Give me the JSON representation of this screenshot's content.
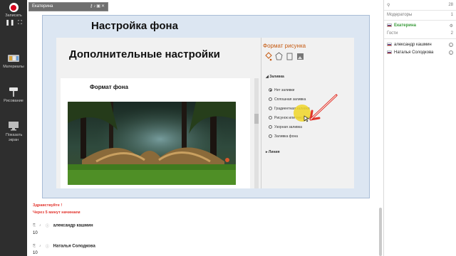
{
  "leftbar": {
    "record_label": "Записать",
    "materials_label": "Материалы",
    "drawing_label": "Рисование",
    "share_label": "Показать экран"
  },
  "video": {
    "title": "Екатерина"
  },
  "slide": {
    "title": "Настройка фона",
    "inner_title": "Дополнительные настройки",
    "format_label": "Формат фона",
    "pane_title": "Формат рисунка",
    "pane_section": "Заливка",
    "options": [
      "Нет заливки",
      "Сплошная заливка",
      "Градиентная заливка",
      "Рисунок или текстура",
      "Узорная заливка",
      "Заливка фона"
    ],
    "pane_line": "Линия"
  },
  "chat": {
    "greeting": "Здравствуйте !",
    "start_note": "Через 5 минут начинаем",
    "messages": [
      {
        "author": "александр кашмин",
        "text": "10"
      },
      {
        "author": "Наталья Солодкова",
        "text": "10"
      }
    ]
  },
  "right": {
    "top_count": "28",
    "moderators_label": "Модераторы",
    "moderators_count": "1",
    "moderator_name": "Екатерина",
    "guests_label": "Гости",
    "guests_count": "2",
    "guests": [
      "александр кашмин",
      "Наталья Солодкова"
    ]
  },
  "colors": {
    "record": "#d6001c",
    "active_user": "#3a9b3a",
    "system_message": "#e2362f",
    "pane_title": "#c55a11",
    "highlight": "#f0d628"
  }
}
